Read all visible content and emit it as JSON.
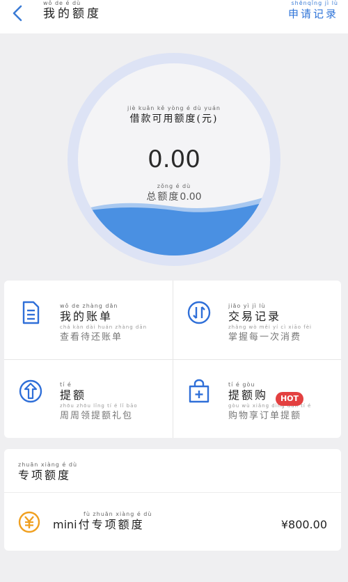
{
  "header": {
    "back_icon": "back-chevron-icon",
    "title_pinyin": "wǒ  de  é  dù",
    "title": "我的额度",
    "link_pinyin": "shēnqǐng  jì  lù",
    "link": "申请记录"
  },
  "quota": {
    "label_pinyin": "jiè kuǎn kě yòng é dù yuán",
    "label": "借款可用额度(元)",
    "value": "0.00",
    "total_pinyin": "zǒng é dù",
    "total_label": "总额度",
    "total_value": "0.00",
    "fill_fraction": 0.25,
    "wave_color": "#4a90e2",
    "ring_color": "#dde3f5"
  },
  "grid": {
    "items": [
      {
        "icon": "bill-document-icon",
        "title_pinyin": "wǒ  de zhàng dān",
        "title": "我的账单",
        "sub_pinyin": "chá kàn dài huán zhàng dān",
        "sub": "查看待还账单"
      },
      {
        "icon": "transaction-arrows-icon",
        "title_pinyin": "jiāo  yì   jì  lù",
        "title": "交易记录",
        "sub_pinyin": "zhǎng wò měi  yí  cì xiāo fèi",
        "sub": "掌握每一次消费"
      },
      {
        "icon": "location-pin-icon",
        "title_pinyin": "tí   é",
        "title": "提额",
        "sub_pinyin": "zhōu zhōu lǐng  tí   é   lǐ  bāo",
        "sub": "周周领提额礼包"
      },
      {
        "icon": "shopping-bag-plus-icon",
        "title_pinyin": "tí   é  gòu",
        "title": "提额购",
        "sub_pinyin": "gòu wù xiǎng dìng dān  tí   é",
        "sub": "购物享订单提额",
        "badge": "HOT"
      }
    ],
    "accent": "#2f6fd8",
    "badge_color": "#e34040"
  },
  "special": {
    "title_pinyin": "zhuān xiàng  é  dù",
    "title": "专项额度",
    "item": {
      "icon": "yuan-coin-icon",
      "pinyin": "fù zhuān xiàng  é  dù",
      "prefix": "mini",
      "name": "付专项额度",
      "amount": "¥800.00"
    },
    "icon_color": "#f0a020"
  }
}
